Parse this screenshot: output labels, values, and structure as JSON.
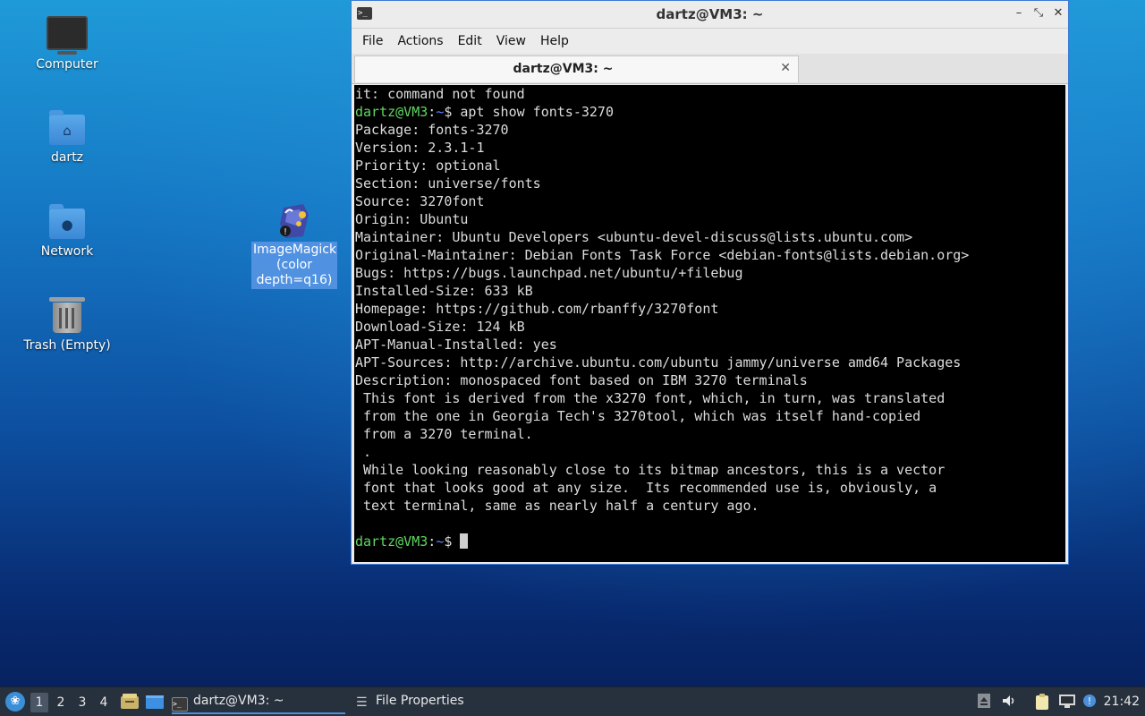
{
  "desktop": {
    "icons": [
      {
        "label": "Computer"
      },
      {
        "label": "dartz"
      },
      {
        "label": "Network"
      },
      {
        "label": "Trash (Empty)"
      },
      {
        "label": "ImageMagick (color depth=q16)"
      }
    ]
  },
  "window": {
    "title": "dartz@VM3: ~",
    "minimize_glyph": "–",
    "maximize_glyph": "⤡",
    "close_glyph": "✕",
    "menus": [
      "File",
      "Actions",
      "Edit",
      "View",
      "Help"
    ],
    "tab": {
      "label": "dartz@VM3: ~",
      "close_glyph": "✕"
    }
  },
  "terminal": {
    "prompt_user": "dartz@VM3",
    "prompt_path": "~",
    "prompt_symbol": "$",
    "lines": [
      "it: command not found",
      "Package: fonts-3270",
      "Version: 2.3.1-1",
      "Priority: optional",
      "Section: universe/fonts",
      "Source: 3270font",
      "Origin: Ubuntu",
      "Maintainer: Ubuntu Developers <ubuntu-devel-discuss@lists.ubuntu.com>",
      "Original-Maintainer: Debian Fonts Task Force <debian-fonts@lists.debian.org>",
      "Bugs: https://bugs.launchpad.net/ubuntu/+filebug",
      "Installed-Size: 633 kB",
      "Homepage: https://github.com/rbanffy/3270font",
      "Download-Size: 124 kB",
      "APT-Manual-Installed: yes",
      "APT-Sources: http://archive.ubuntu.com/ubuntu jammy/universe amd64 Packages",
      "Description: monospaced font based on IBM 3270 terminals",
      " This font is derived from the x3270 font, which, in turn, was translated",
      " from the one in Georgia Tech's 3270tool, which was itself hand-copied",
      " from a 3270 terminal.",
      " .",
      " While looking reasonably close to its bitmap ancestors, this is a vector",
      " font that looks good at any size.  Its recommended use is, obviously, a",
      " text terminal, same as nearly half a century ago."
    ],
    "command": "apt show fonts-3270"
  },
  "taskbar": {
    "workspaces": [
      "1",
      "2",
      "3",
      "4"
    ],
    "tasks": [
      {
        "label": "dartz@VM3: ~"
      },
      {
        "label": "File Properties"
      }
    ],
    "clock": "21:42"
  },
  "colors": {
    "prompt_user": "#5fd75f",
    "prompt_path": "#5f87ff",
    "accent": "#3b7bd4"
  }
}
